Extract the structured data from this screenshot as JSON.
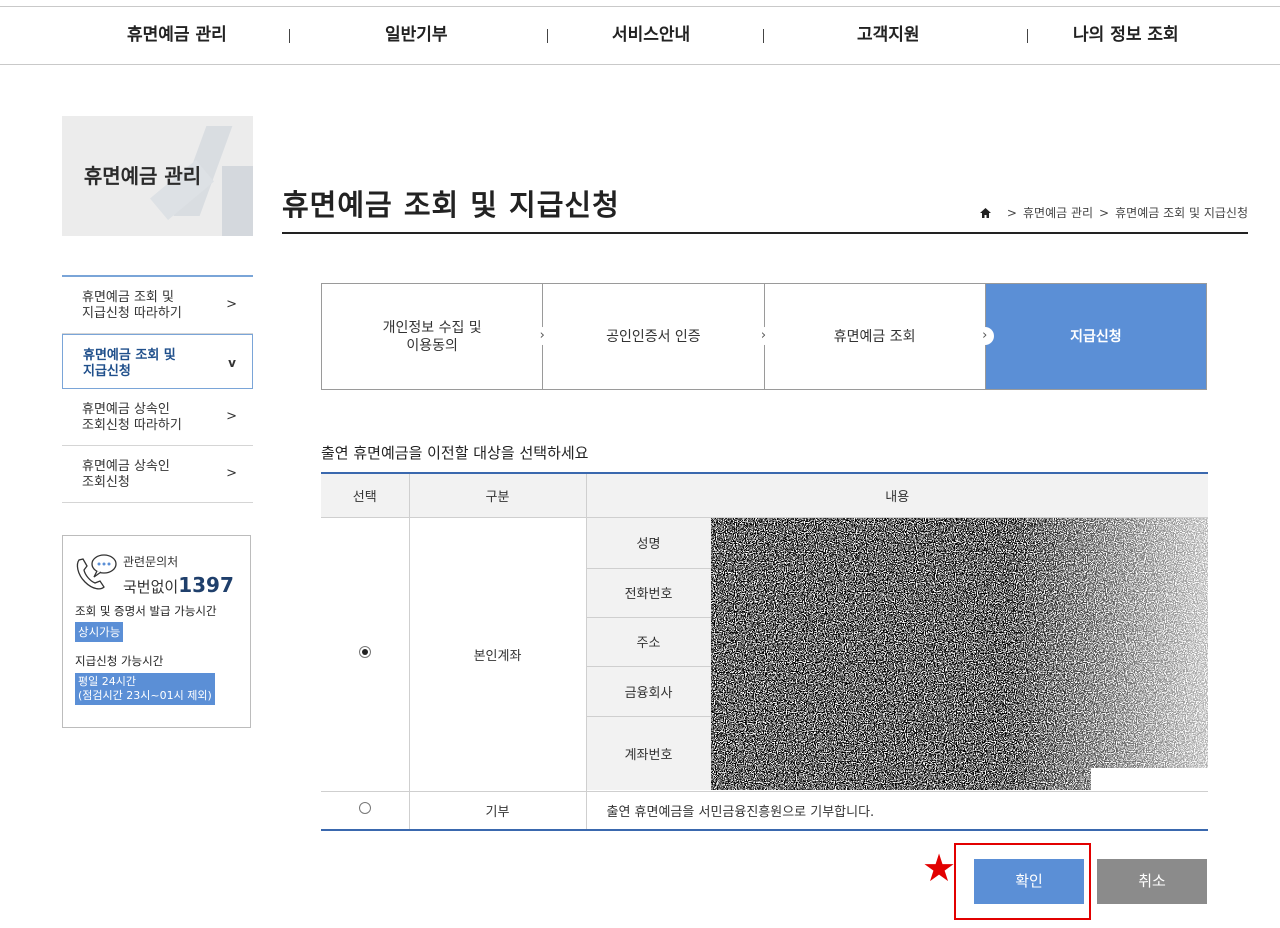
{
  "topnav": {
    "items": [
      "휴면예금 관리",
      "일반기부",
      "서비스안내",
      "고객지원",
      "나의 정보 조회"
    ]
  },
  "side": {
    "banner_title": "휴면예금 관리",
    "menu": [
      {
        "line1": "휴면예금 조회 및",
        "line2": "지급신청 따라하기",
        "arrow": ">"
      },
      {
        "line1": "휴면예금 조회 및",
        "line2": "지급신청",
        "arrow": "v"
      },
      {
        "line1": "휴면예금 상속인",
        "line2": "조회신청 따라하기",
        "arrow": ">"
      },
      {
        "line1": "휴면예금 상속인",
        "line2": "조회신청",
        "arrow": ">"
      }
    ],
    "contact": {
      "label": "관련문의처",
      "prefix": "국번없이",
      "number": "1397",
      "line1": "조회 및 증명서 발급 가능시간",
      "badge1": "상시가능",
      "line2": "지급신청 가능시간",
      "badge2_line1": "평일 24시간",
      "badge2_line2": "(점검시간 23시~01시 제외)"
    }
  },
  "page": {
    "title": "휴면예금 조회 및 지급신청",
    "breadcrumb": [
      ">",
      "휴면예금 관리",
      ">",
      "휴면예금 조회 및 지급신청"
    ]
  },
  "steps": [
    {
      "line1": "개인정보 수집 및",
      "line2": "이용동의"
    },
    {
      "line1": "공인인증서 인증",
      "line2": ""
    },
    {
      "line1": "휴면예금 조회",
      "line2": ""
    },
    {
      "line1": "지급신청",
      "line2": ""
    }
  ],
  "instruction": "출연 휴면예금을 이전할 대상을 선택하세요",
  "table": {
    "headers": [
      "선택",
      "구분",
      "내용"
    ],
    "row1": {
      "type": "본인계좌",
      "fields": [
        "성명",
        "전화번호",
        "주소",
        "금융회사",
        "계좌번호"
      ],
      "selected": true
    },
    "row2": {
      "type": "기부",
      "content": "출연 휴면예금을 서민금융진흥원으로 기부합니다.",
      "selected": false
    }
  },
  "buttons": {
    "confirm": "확인",
    "cancel": "취소"
  },
  "annotation": {
    "star": "★"
  },
  "colors": {
    "accent": "#5b8fd6",
    "table_border": "#3a68ae",
    "highlight": "#e20000",
    "cancel": "#8b8b8b"
  }
}
